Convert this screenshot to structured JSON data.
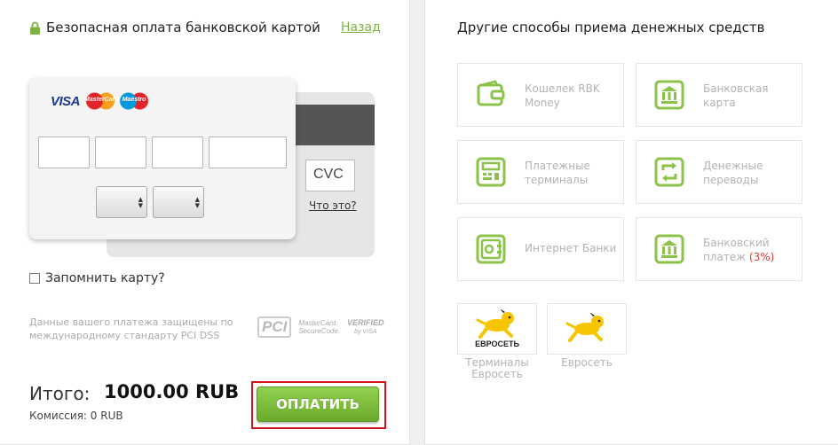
{
  "header": {
    "title": "Безопасная оплата банковской картой",
    "back_link": "Назад"
  },
  "card": {
    "brands": [
      "VISA",
      "MasterCard",
      "Maestro"
    ],
    "card_number_fields": [
      "",
      "",
      "",
      ""
    ],
    "expiry_month": "",
    "expiry_year": "",
    "cvc_placeholder": "CVC",
    "cvc_help_link": "Что это?"
  },
  "remember": {
    "label": "Запомнить карту?",
    "checked": false
  },
  "security": {
    "text": "Данные вашего платежа защищены по международному стандарту PCI DSS",
    "logos": {
      "pci": "PCI",
      "mastercard_line1": "MasterCard.",
      "mastercard_line2": "SecureCode.",
      "verified_line1": "VERIFIED",
      "verified_line2": "by VISA"
    }
  },
  "total": {
    "label": "Итого:",
    "amount": "1000.00 RUB",
    "commission": "Комиссия: 0 RUB"
  },
  "pay_button": "ОПЛАТИТЬ",
  "other_methods": {
    "title": "Другие способы приема денежных средств",
    "items": [
      {
        "line1": "Кошелек RBK",
        "line2": "Money",
        "icon": "wallet-icon"
      },
      {
        "line1": "Банковская",
        "line2": "карта",
        "icon": "bank-icon"
      },
      {
        "line1": "Платежные",
        "line2": "терминалы",
        "icon": "terminal-icon"
      },
      {
        "line1": "Денежные",
        "line2": "переводы",
        "icon": "transfer-icon"
      },
      {
        "line1": "Интернет Банки",
        "icon": "safe-icon"
      },
      {
        "line1": "Банковский",
        "line2": "платеж",
        "badge": "(3%)",
        "icon": "bank-icon"
      }
    ],
    "euroset": [
      {
        "logo_text": "ЕВРОСЕТЬ",
        "caption1": "Терминалы",
        "caption2": "Евросеть"
      },
      {
        "caption1": "Евросеть"
      }
    ]
  },
  "colors": {
    "accent_green": "#7cb342",
    "button_green": "#7dbd3b",
    "highlight_red": "#d4131a",
    "badge_red": "#e53935"
  }
}
